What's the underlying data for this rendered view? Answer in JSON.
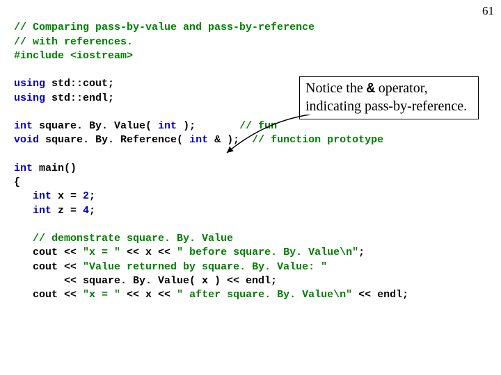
{
  "page_number": "61",
  "code": {
    "l1": "// Comparing pass-by-value and pass-by-reference",
    "l2": "// with references.",
    "l3_a": "#include ",
    "l3_b": "<iostream>",
    "l5_a": "using ",
    "l5_b": "std::cout;",
    "l6_a": "using ",
    "l6_b": "std::endl;",
    "l8_a": "int",
    "l8_b": " square. By. Value( ",
    "l8_c": "int",
    "l8_d": " );       ",
    "l8_e": "// fun",
    "l9_a": "void",
    "l9_b": " square. By. Reference( ",
    "l9_c": "int",
    "l9_d": " & );  ",
    "l9_e": "// function prototype",
    "l11_a": "int",
    "l11_b": " main()",
    "l12": "{",
    "l13_a": "   int",
    "l13_b": " x = ",
    "l13_c": "2",
    "l13_d": ";",
    "l14_a": "   int",
    "l14_b": " z = ",
    "l14_c": "4",
    "l14_d": ";",
    "l16": "   // demonstrate square. By. Value",
    "l17_a": "   cout << ",
    "l17_b": "\"x = \"",
    "l17_c": " << x << ",
    "l17_d": "\" before square. By. Value\\n\"",
    "l17_e": ";",
    "l18_a": "   cout << ",
    "l18_b": "\"Value returned by square. By. Value: \"",
    "l19_a": "        << square. By. Value( x ) << endl;",
    "l20_a": "   cout << ",
    "l20_b": "\"x = \"",
    "l20_c": " << x << ",
    "l20_d": "\" after square. By. Value\\n\"",
    "l20_e": " << endl;"
  },
  "callout": {
    "part1": "Notice the ",
    "amp": "&",
    "part2": " operator, indicating pass-by-reference."
  }
}
